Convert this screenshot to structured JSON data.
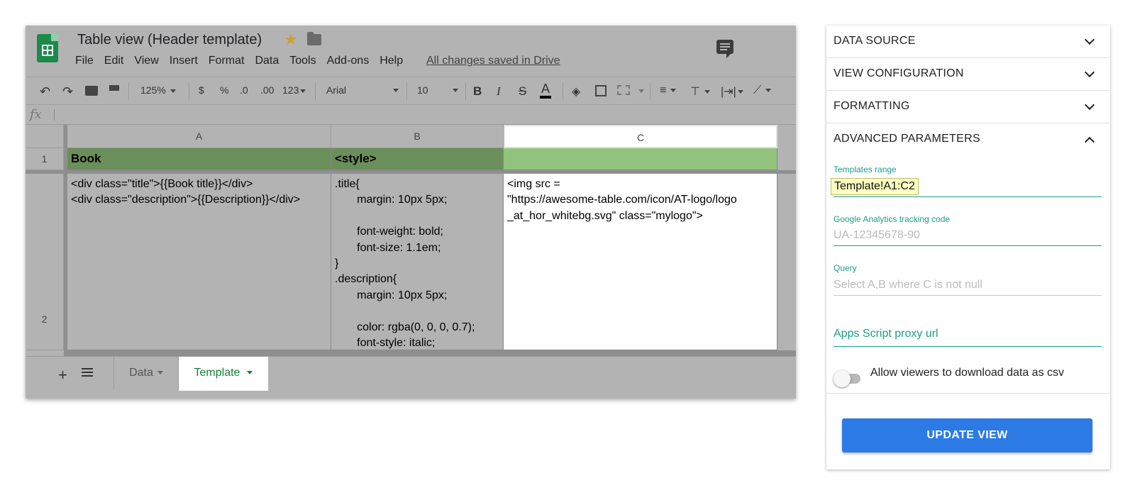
{
  "sheet": {
    "title": "Table view (Header template)",
    "menu": [
      "File",
      "Edit",
      "View",
      "Insert",
      "Format",
      "Data",
      "Tools",
      "Add-ons",
      "Help"
    ],
    "saved_status": "All changes saved in Drive",
    "toolbar": {
      "zoom": "125%",
      "currency": "$",
      "percent": "%",
      "decrease_decimals": ".0",
      "increase_decimals": ".00",
      "more_formats": "123",
      "font": "Arial",
      "font_size": "10",
      "bold": "B",
      "italic": "I",
      "strikethrough": "S",
      "text_color": "A"
    },
    "fx_symbol": "fx",
    "columns": [
      "A",
      "B",
      "C"
    ],
    "rows": [
      "1",
      "2"
    ],
    "cells": {
      "A1": "Book",
      "B1": "<style>",
      "C1": "",
      "A2": "<div class=\"title\">{{Book title}}</div>\n<div class=\"description\">{{Description}}</div>",
      "B2": ".title{\n       margin: 10px 5px;\n\n       font-weight: bold;\n       font-size: 1.1em;\n}\n.description{\n       margin: 10px 5px;\n\n       color: rgba(0, 0, 0, 0.7);\n       font-style: italic;",
      "C2": "<img src =\n\"https://awesome-table.com/icon/AT-logo/logo\n_at_hor_whitebg.svg\" class=\"mylogo\">"
    },
    "tabs": [
      {
        "label": "Data",
        "active": false
      },
      {
        "label": "Template",
        "active": true
      }
    ],
    "add_sheet_symbol": "+",
    "star_symbol": "★",
    "colors": {
      "header_row_dimmed": "#6b8f5a",
      "header_row_highlight": "#93c47d",
      "accent": "#188038"
    }
  },
  "panel": {
    "sections": [
      {
        "label": "DATA SOURCE",
        "expanded": false
      },
      {
        "label": "VIEW CONFIGURATION",
        "expanded": false
      },
      {
        "label": "FORMATTING",
        "expanded": false
      },
      {
        "label": "ADVANCED PARAMETERS",
        "expanded": true
      }
    ],
    "templates_range": {
      "label": "Templates range",
      "value": "Template!A1:C2"
    },
    "ga_code": {
      "label": "Google Analytics tracking code",
      "placeholder": "UA-12345678-90"
    },
    "query": {
      "label": "Query",
      "placeholder": "Select A,B where C is not null"
    },
    "proxy": {
      "label": "Apps Script proxy url"
    },
    "csv_toggle": {
      "label": "Allow viewers to download data as csv",
      "on": false
    },
    "update_button": "UPDATE VIEW",
    "colors": {
      "accent": "#1e9c8a",
      "button": "#2b7ae6"
    }
  }
}
